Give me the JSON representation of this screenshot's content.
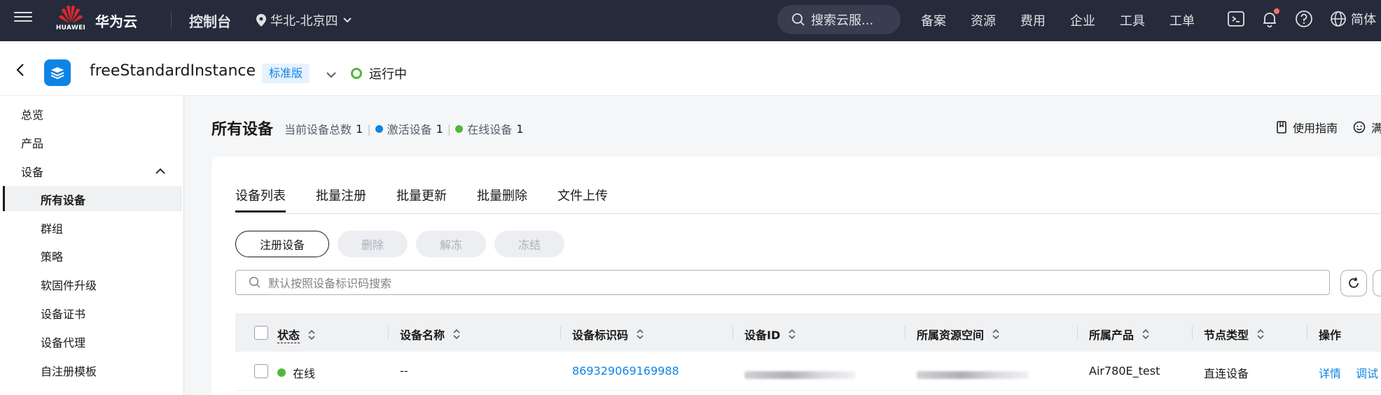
{
  "topnav": {
    "logo_text": "HUAWEI",
    "brand": "华为云",
    "console": "控制台",
    "region": "华北-北京四",
    "search_placeholder": "搜索云服...",
    "links": [
      "备案",
      "资源",
      "费用",
      "企业",
      "工具",
      "工单"
    ],
    "lang": "简体"
  },
  "instance": {
    "name": "freeStandardInstance",
    "edition": "标准版",
    "status": "运行中"
  },
  "sidebar": {
    "items": [
      "总览",
      "产品",
      "设备"
    ],
    "sub_items": [
      "所有设备",
      "群组",
      "策略",
      "软固件升级",
      "设备证书",
      "设备代理",
      "自注册模板"
    ]
  },
  "main": {
    "title": "所有设备",
    "total_label": "当前设备总数",
    "total_value": "1",
    "active_label": "激活设备",
    "active_value": "1",
    "online_label": "在线设备",
    "online_value": "1",
    "guide": "使用指南",
    "guide2": "满",
    "tabs": [
      "设备列表",
      "批量注册",
      "批量更新",
      "批量删除",
      "文件上传"
    ],
    "buttons": {
      "register": "注册设备",
      "delete": "删除",
      "unfreeze": "解冻",
      "freeze": "冻结"
    },
    "search_placeholder": "默认按照设备标识码搜索"
  },
  "table": {
    "columns": [
      "状态",
      "设备名称",
      "设备标识码",
      "设备ID",
      "所属资源空间",
      "所属产品",
      "节点类型",
      "操作"
    ],
    "rows": [
      {
        "status": "在线",
        "name": "--",
        "identifier": "869329069169988",
        "device_id_tail": "...a_7",
        "space_tail": "...f",
        "product": "Air780E_test",
        "node_type": "直连设备",
        "actions": [
          "详情",
          "调试"
        ]
      }
    ]
  },
  "colors": {
    "nav_bg": "#252b3a",
    "accent": "#0e84e5",
    "online": "#50b83c",
    "active_dot": "#0e84e5"
  }
}
